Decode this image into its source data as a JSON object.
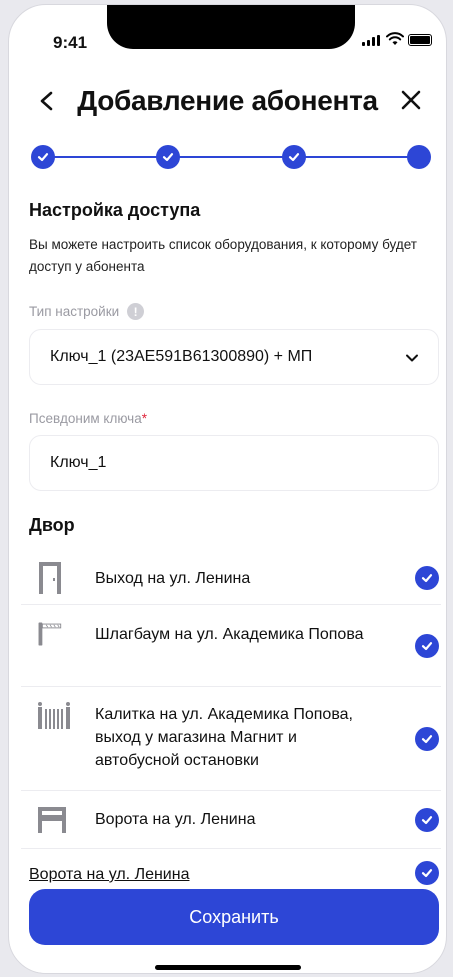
{
  "status_bar": {
    "time": "9:41"
  },
  "header": {
    "title": "Добавление абонента"
  },
  "stepper": {
    "total": 4,
    "completed": 3,
    "current": 4
  },
  "section": {
    "title": "Настройка доступа",
    "description": "Вы можете настроить список оборудования, к которому будет доступ у абонента"
  },
  "access_type": {
    "label": "Тип настройки",
    "value": "Ключ_1 (23AE591B61300890) + МП"
  },
  "key_alias": {
    "label": "Псевдоним ключа",
    "required_mark": "*",
    "value": "Ключ_1"
  },
  "yard": {
    "title": "Двор",
    "items": [
      {
        "icon": "door-icon",
        "label": "Выход на ул. Ленина",
        "checked": true
      },
      {
        "icon": "barrier-icon",
        "label": "Шлагбаум на ул. Академика Попова",
        "checked": true
      },
      {
        "icon": "wicket-icon",
        "label": "Калитка на ул. Академика Попова, выход у магазина Магнит и автобусной остановки",
        "checked": true
      },
      {
        "icon": "gate-icon",
        "label": "Ворота на ул. Ленина",
        "checked": true
      },
      {
        "icon": "",
        "label": "Ворота на ул. Ленина",
        "checked": true
      }
    ]
  },
  "save_button": {
    "label": "Сохранить"
  },
  "colors": {
    "accent": "#2d46d6",
    "required": "#e0263c"
  }
}
